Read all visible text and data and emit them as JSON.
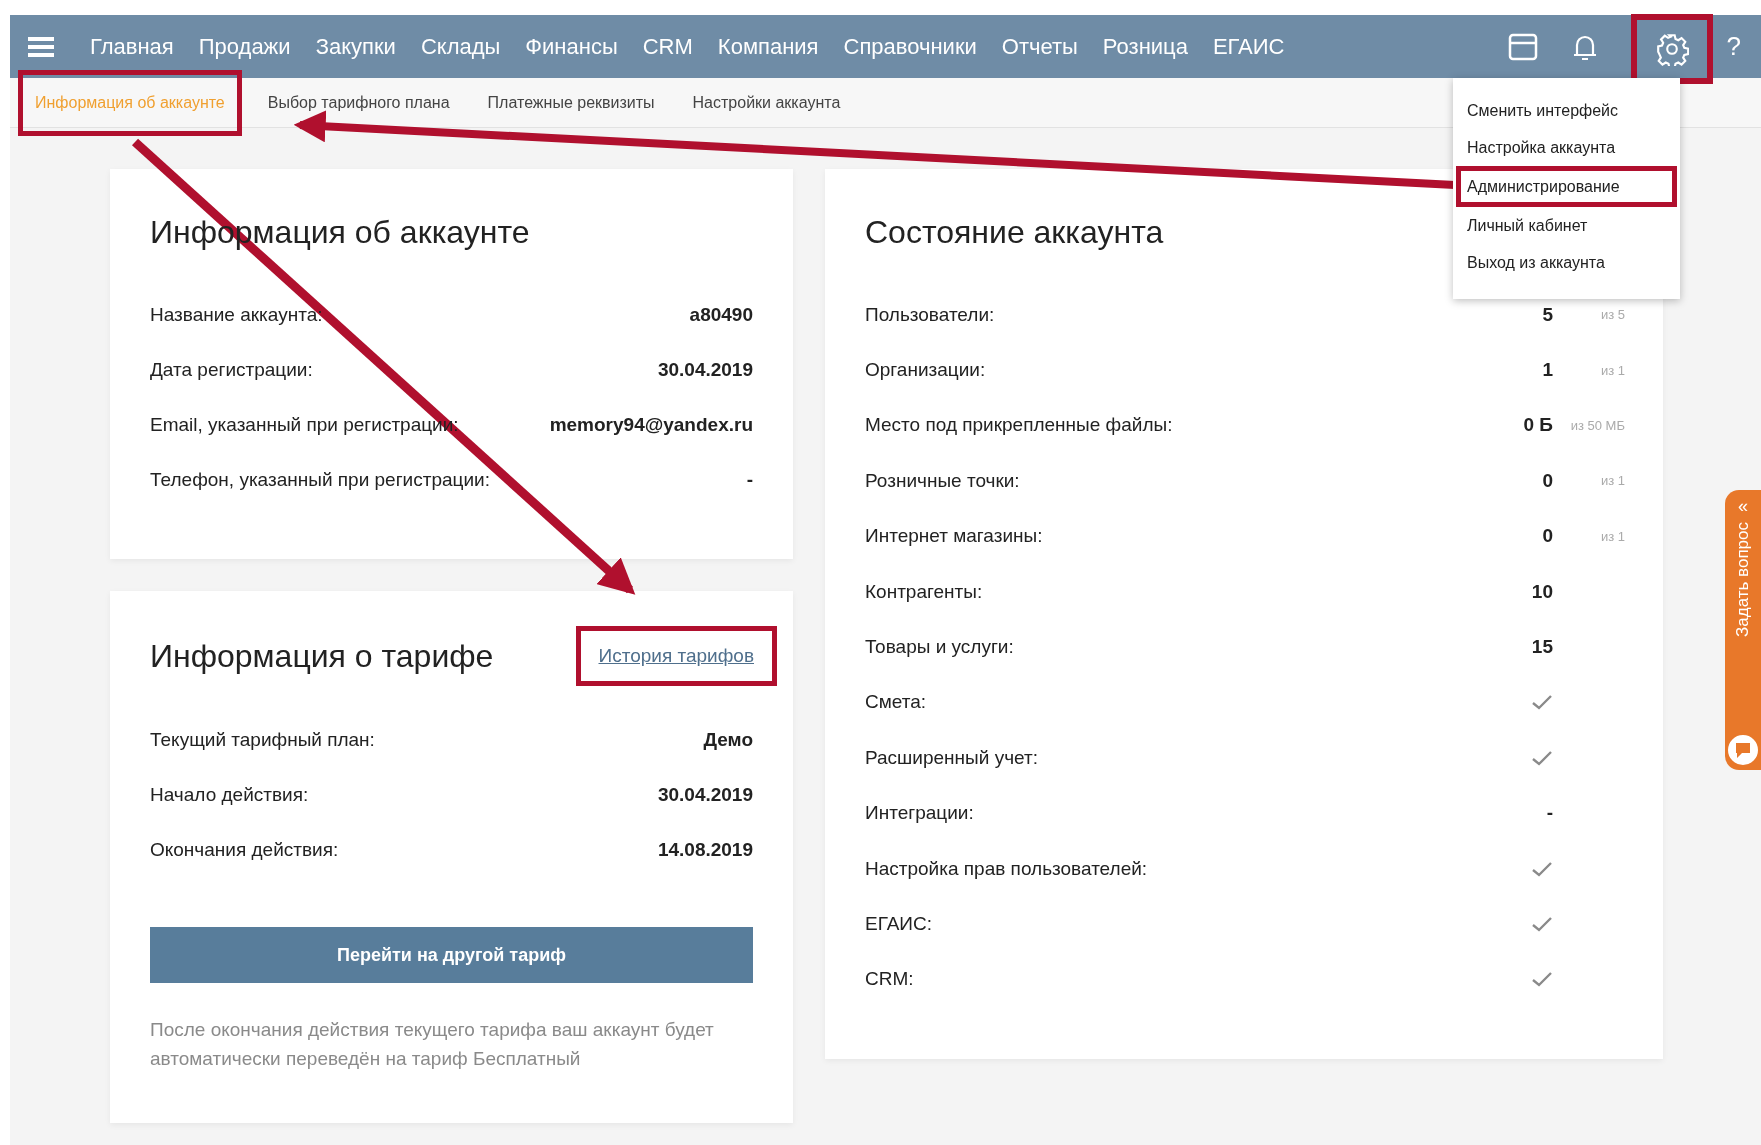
{
  "top_nav": {
    "items": [
      "Главная",
      "Продажи",
      "Закупки",
      "Склады",
      "Финансы",
      "CRM",
      "Компания",
      "Справочники",
      "Отчеты",
      "Розница",
      "ЕГАИС"
    ],
    "settings_highlighted": true,
    "help": "?"
  },
  "sub_tabs": [
    {
      "label": "Информация об аккаунте",
      "selected": true,
      "highlighted": true
    },
    {
      "label": "Выбор тарифного плана",
      "selected": false,
      "highlighted": false
    },
    {
      "label": "Платежные реквизиты",
      "selected": false,
      "highlighted": false
    },
    {
      "label": "Настройки аккаунта",
      "selected": false,
      "highlighted": false
    }
  ],
  "settings_menu": [
    {
      "label": "Сменить интерфейс",
      "highlighted": false
    },
    {
      "label": "Настройка аккаунта",
      "highlighted": false
    },
    {
      "label": "Администрирование",
      "highlighted": true
    },
    {
      "label": "Личный кабинет",
      "highlighted": false
    },
    {
      "label": "Выход из аккаунта",
      "highlighted": false
    }
  ],
  "account_info": {
    "title": "Информация об аккаунте",
    "rows": [
      {
        "label": "Название аккаунта:",
        "value": "a80490"
      },
      {
        "label": "Дата регистрации:",
        "value": "30.04.2019"
      },
      {
        "label": "Email, указанный при регистрации:",
        "value": "memory94@yandex.ru"
      },
      {
        "label": "Телефон, указанный при регистрации:",
        "value": "-"
      }
    ]
  },
  "tariff_info": {
    "title": "Информация о тарифе",
    "history_link": {
      "label": "История тарифов",
      "highlighted": true
    },
    "rows": [
      {
        "label": "Текущий тарифный план:",
        "value": "Демо"
      },
      {
        "label": "Начало действия:",
        "value": "30.04.2019"
      },
      {
        "label": "Окончания действия:",
        "value": "14.08.2019"
      }
    ],
    "button": "Перейти на другой тариф",
    "note": "После окончания действия текущего тарифа ваш аккаунт будет автоматически переведён на тариф Бесплатный"
  },
  "account_status": {
    "title": "Состояние аккаунта",
    "rows": [
      {
        "kind": "count",
        "label": "Пользователи:",
        "value": "5",
        "limit": "из 5"
      },
      {
        "kind": "count",
        "label": "Организации:",
        "value": "1",
        "limit": "из 1"
      },
      {
        "kind": "count",
        "label": "Место под прикрепленные файлы:",
        "value": "0 Б",
        "limit": "из 50 МБ"
      },
      {
        "kind": "count",
        "label": "Розничные точки:",
        "value": "0",
        "limit": "из 1"
      },
      {
        "kind": "count",
        "label": "Интернет магазины:",
        "value": "0",
        "limit": "из 1"
      },
      {
        "kind": "count",
        "label": "Контрагенты:",
        "value": "10"
      },
      {
        "kind": "count",
        "label": "Товары и услуги:",
        "value": "15"
      },
      {
        "kind": "check",
        "label": "Смета:"
      },
      {
        "kind": "check",
        "label": "Расширенный учет:"
      },
      {
        "kind": "count",
        "label": "Интеграции:",
        "value": "-"
      },
      {
        "kind": "check",
        "label": "Настройка прав пользователей:"
      },
      {
        "kind": "check",
        "label": "ЕГАИС:"
      },
      {
        "kind": "check",
        "label": "CRM:"
      }
    ]
  },
  "feedback_tab": {
    "label": "Задать вопрос",
    "collapse": "«"
  }
}
